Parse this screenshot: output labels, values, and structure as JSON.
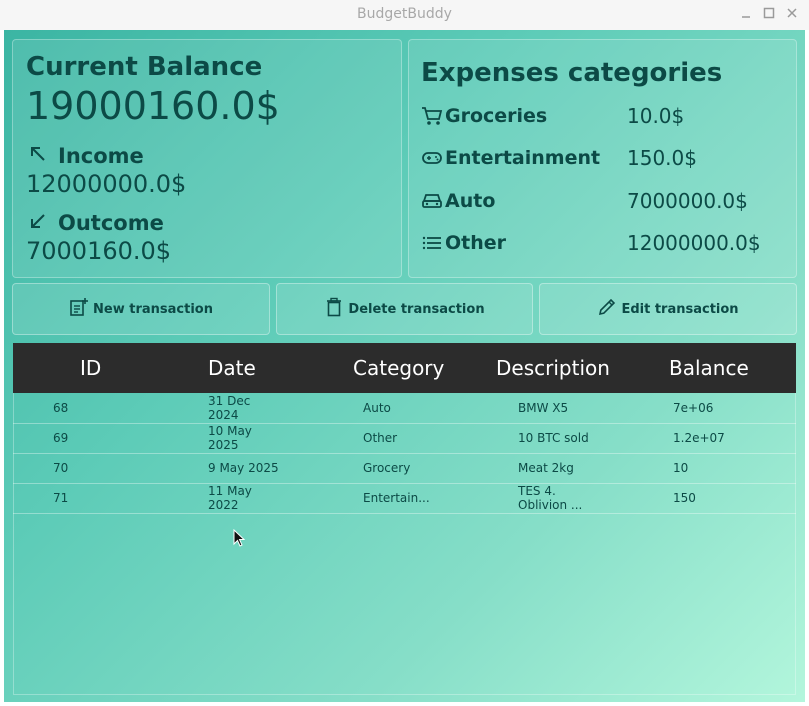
{
  "window": {
    "title": "BudgetBuddy"
  },
  "balance": {
    "title": "Current Balance",
    "value": "19000160.0$",
    "income_label": "Income",
    "income_value": "12000000.0$",
    "outcome_label": "Outcome",
    "outcome_value": "7000160.0$"
  },
  "categories": {
    "title": "Expenses categories",
    "items": [
      {
        "name": "Groceries",
        "value": "10.0$",
        "icon": "cart-icon"
      },
      {
        "name": "Entertainment",
        "value": "150.0$",
        "icon": "gamepad-icon"
      },
      {
        "name": "Auto",
        "value": "7000000.0$",
        "icon": "car-icon"
      },
      {
        "name": "Other",
        "value": "12000000.0$",
        "icon": "list-icon"
      }
    ]
  },
  "toolbar": {
    "new_label": "New transaction",
    "delete_label": "Delete transaction",
    "edit_label": "Edit transaction"
  },
  "table": {
    "columns": [
      "ID",
      "Date",
      "Category",
      "Description",
      "Balance"
    ],
    "rows": [
      {
        "id": "68",
        "date": [
          "31 Dec",
          "2024"
        ],
        "category": "Auto",
        "description": [
          "BMW X5"
        ],
        "balance": "7e+06"
      },
      {
        "id": "69",
        "date": [
          "10 May",
          "2025"
        ],
        "category": "Other",
        "description": [
          "10 BTC sold"
        ],
        "balance": "1.2e+07"
      },
      {
        "id": "70",
        "date": [
          "9 May 2025"
        ],
        "category": "Grocery",
        "description": [
          "Meat 2kg"
        ],
        "balance": "10"
      },
      {
        "id": "71",
        "date": [
          "11 May",
          "2022"
        ],
        "category": "Entertain...",
        "description": [
          "TES 4.",
          "Oblivion ..."
        ],
        "balance": "150"
      }
    ]
  }
}
